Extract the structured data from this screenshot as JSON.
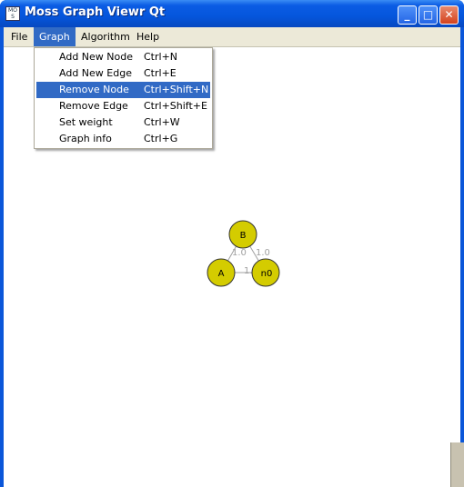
{
  "window": {
    "title": "Moss Graph Viewr Qt",
    "app_icon_text": "MO S"
  },
  "titlebar_buttons": {
    "minimize": "_",
    "maximize": "□",
    "close": "✕"
  },
  "menubar": {
    "items": [
      {
        "label": "File"
      },
      {
        "label": "Graph"
      },
      {
        "label": "Algorithm"
      },
      {
        "label": "Help"
      }
    ]
  },
  "graph_menu": {
    "items": [
      {
        "label": "Add New Node",
        "shortcut": "Ctrl+N"
      },
      {
        "label": "Add New Edge",
        "shortcut": "Ctrl+E"
      },
      {
        "label": "Remove Node",
        "shortcut": "Ctrl+Shift+N"
      },
      {
        "label": "Remove Edge",
        "shortcut": "Ctrl+Shift+E"
      },
      {
        "label": "Set weight",
        "shortcut": "Ctrl+W"
      },
      {
        "label": "Graph info",
        "shortcut": "Ctrl+G"
      }
    ],
    "highlighted_index": 2
  },
  "graph": {
    "nodes": [
      {
        "label": "B"
      },
      {
        "label": "A"
      },
      {
        "label": "n0"
      }
    ],
    "edge_weights": {
      "B_A": "1.0",
      "B_n0": "1.0",
      "A_n0": "1."
    },
    "node_color": "#d4cc00",
    "edge_color": "#a0a0a0"
  },
  "colors": {
    "menu_highlight": "#316ac5",
    "titlebar": "#0556dc"
  }
}
